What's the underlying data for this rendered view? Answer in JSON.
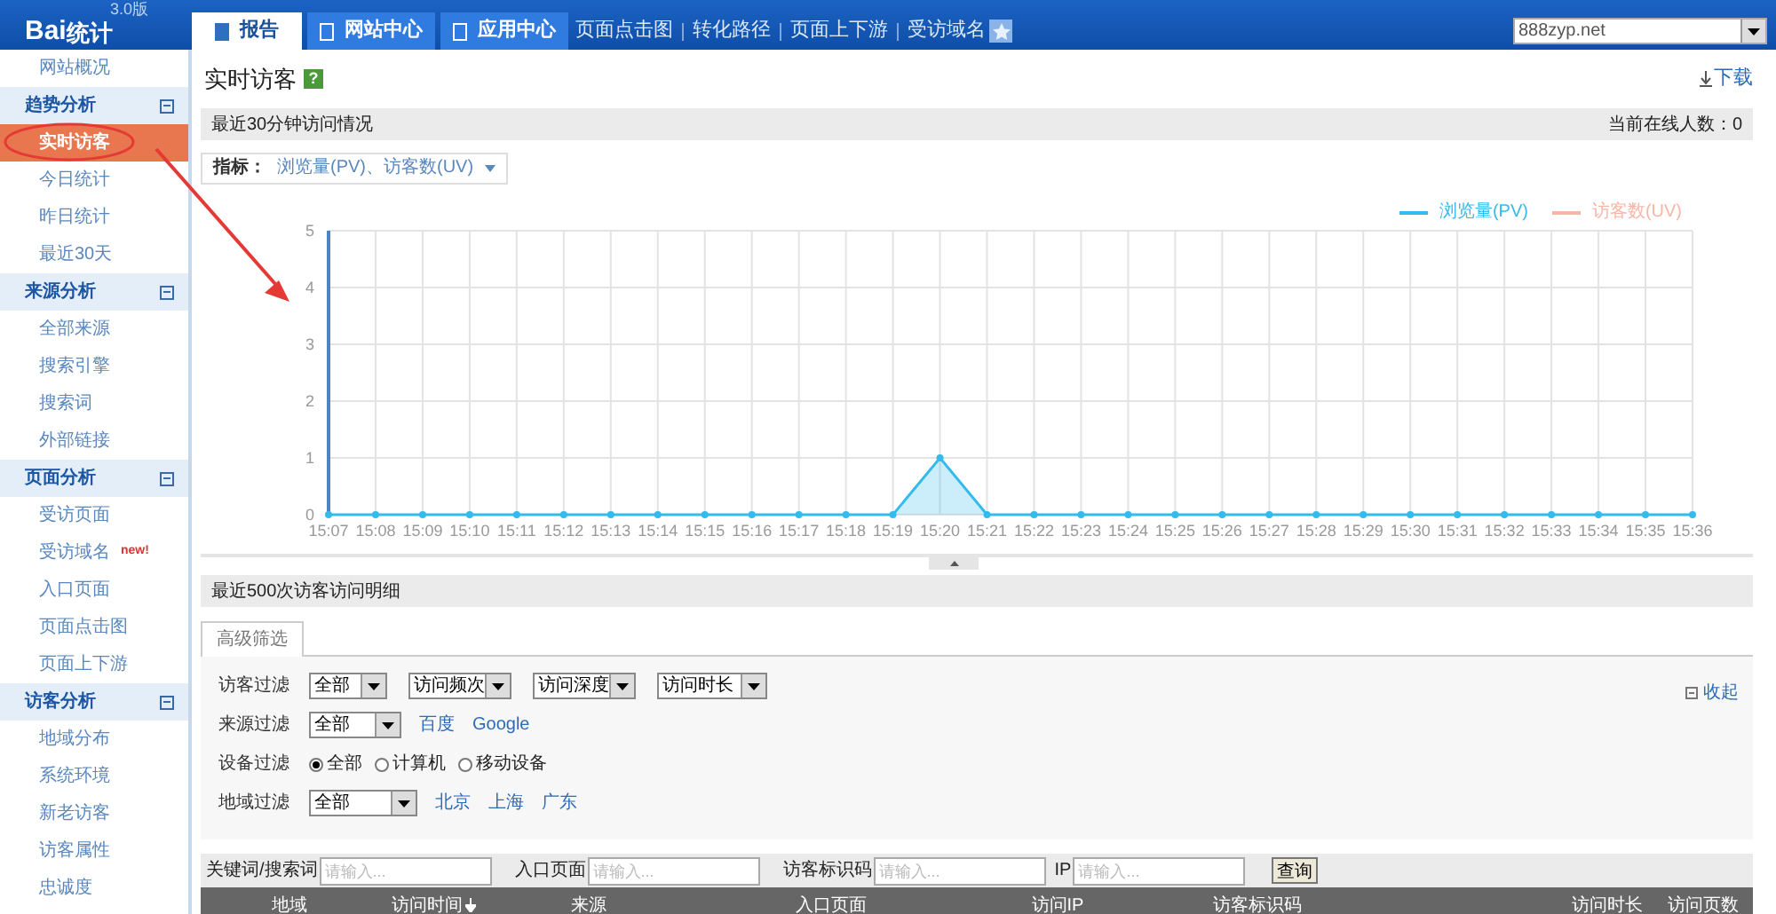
{
  "header": {
    "logo": "Bai",
    "logo_suffix": "统计",
    "version": "3.0版",
    "tabs": [
      {
        "label": "报告",
        "selected": true
      },
      {
        "label": "网站中心",
        "selected": false
      },
      {
        "label": "应用中心",
        "selected": false
      }
    ],
    "links": [
      "页面点击图",
      "转化路径",
      "页面上下游",
      "受访域名"
    ],
    "site_select": "888zyp.net"
  },
  "sidebar": {
    "top_item": "网站概况",
    "groups": [
      {
        "title": "趋势分析",
        "expanded": true,
        "items": [
          {
            "label": "实时访客",
            "selected": true
          },
          {
            "label": "今日统计",
            "selected": false
          },
          {
            "label": "昨日统计",
            "selected": false
          },
          {
            "label": "最近30天",
            "selected": false
          }
        ]
      },
      {
        "title": "来源分析",
        "expanded": true,
        "items": [
          {
            "label": "全部来源",
            "selected": false
          },
          {
            "label": "搜索引擎",
            "selected": false
          },
          {
            "label": "搜索词",
            "selected": false
          },
          {
            "label": "外部链接",
            "selected": false
          }
        ]
      },
      {
        "title": "页面分析",
        "expanded": true,
        "items": [
          {
            "label": "受访页面",
            "selected": false
          },
          {
            "label": "受访域名",
            "selected": false,
            "badge": "new!"
          },
          {
            "label": "入口页面",
            "selected": false
          },
          {
            "label": "页面点击图",
            "selected": false
          },
          {
            "label": "页面上下游",
            "selected": false
          }
        ]
      },
      {
        "title": "访客分析",
        "expanded": true,
        "items": [
          {
            "label": "地域分布",
            "selected": false
          },
          {
            "label": "系统环境",
            "selected": false
          },
          {
            "label": "新老访客",
            "selected": false
          },
          {
            "label": "访客属性",
            "selected": false
          },
          {
            "label": "忠诚度",
            "selected": false
          }
        ]
      }
    ]
  },
  "page": {
    "title": "实时访客",
    "help": "?",
    "download": "下载"
  },
  "realtime": {
    "title": "最近30分钟访问情况",
    "online": "当前在线人数：0",
    "metric_label": "指标：",
    "metric_value": "浏览量(PV)、访客数(UV)",
    "chart_data": {
      "type": "area",
      "x": [
        "15:07",
        "15:08",
        "15:09",
        "15:10",
        "15:11",
        "15:12",
        "15:13",
        "15:14",
        "15:15",
        "15:16",
        "15:17",
        "15:18",
        "15:19",
        "15:20",
        "15:21",
        "15:22",
        "15:23",
        "15:24",
        "15:25",
        "15:26",
        "15:27",
        "15:28",
        "15:29",
        "15:30",
        "15:31",
        "15:32",
        "15:33",
        "15:34",
        "15:35",
        "15:36"
      ],
      "ylim": [
        0,
        5
      ],
      "yticks": [
        0,
        1,
        2,
        3,
        4,
        5
      ],
      "series": [
        {
          "name": "浏览量(PV)",
          "color": "#33bbee",
          "values": [
            0,
            0,
            0,
            0,
            0,
            0,
            0,
            0,
            0,
            0,
            0,
            0,
            0,
            1,
            0,
            0,
            0,
            0,
            0,
            0,
            0,
            0,
            0,
            0,
            0,
            0,
            0,
            0,
            0,
            0
          ]
        },
        {
          "name": "访客数(UV)",
          "color": "#f7b5a5",
          "values": [
            null,
            null,
            null,
            null,
            null,
            null,
            null,
            null,
            null,
            null,
            null,
            null,
            null,
            null,
            null,
            null,
            null,
            null,
            null,
            null,
            null,
            null,
            null,
            null,
            null,
            null,
            null,
            null,
            null,
            null
          ]
        }
      ],
      "grid": true
    }
  },
  "detail": {
    "title": "最近500次访客访问明细",
    "filter_tab": "高级筛选",
    "collapse": "收起",
    "filters": [
      {
        "kind": "selects",
        "label": "访客过滤",
        "selects": [
          "全部",
          "访问频次",
          "访问深度",
          "访问时长"
        ]
      },
      {
        "kind": "select_links",
        "label": "来源过滤",
        "select": "全部",
        "links": [
          "百度",
          "Google"
        ]
      },
      {
        "kind": "radios",
        "label": "设备过滤",
        "options": [
          {
            "label": "全部",
            "selected": true
          },
          {
            "label": "计算机",
            "selected": false
          },
          {
            "label": "移动设备",
            "selected": false
          }
        ]
      },
      {
        "kind": "select_links",
        "label": "地域过滤",
        "select": "全部",
        "links": [
          "北京",
          "上海",
          "广东"
        ]
      }
    ],
    "search_fields": [
      {
        "label": "关键词/搜索词",
        "placeholder": "请输入..."
      },
      {
        "label": "入口页面",
        "placeholder": "请输入..."
      },
      {
        "label": "访客标识码",
        "placeholder": "请输入..."
      },
      {
        "label": "IP",
        "placeholder": "请输入..."
      }
    ],
    "search_button": "查询",
    "columns": [
      {
        "label": "地域",
        "sorted": false
      },
      {
        "label": "访问时间",
        "sorted": true
      },
      {
        "label": "来源",
        "sorted": false
      },
      {
        "label": "入口页面",
        "sorted": false
      },
      {
        "label": "访问IP",
        "sorted": false
      },
      {
        "label": "访客标识码",
        "sorted": false
      },
      {
        "label": "访问时长",
        "sorted": false
      },
      {
        "label": "访问页数",
        "sorted": false
      }
    ]
  }
}
